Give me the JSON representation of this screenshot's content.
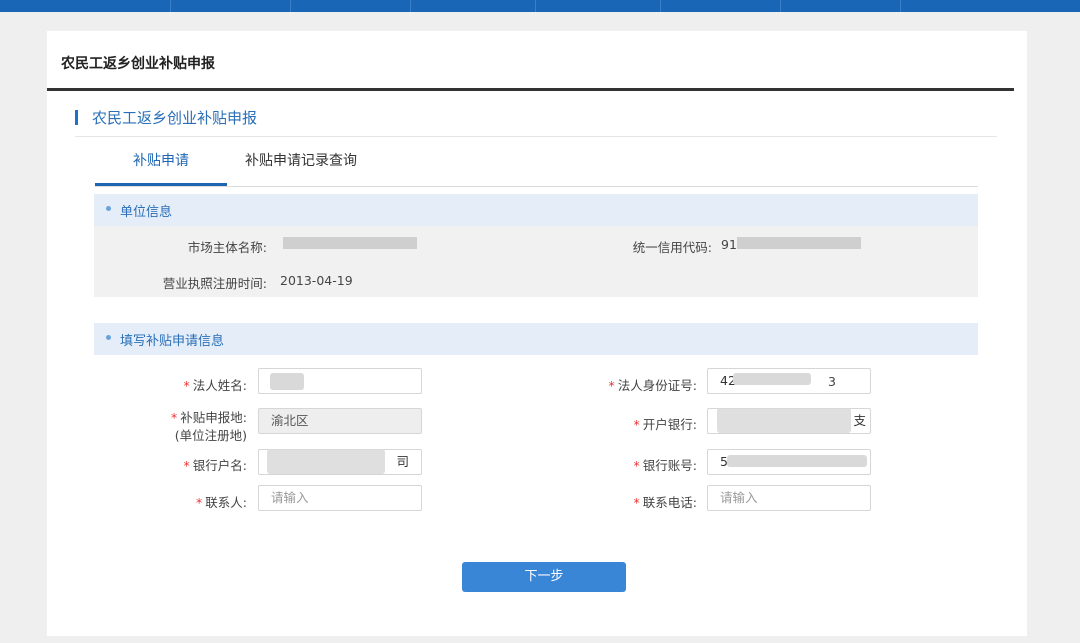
{
  "page_title": "农民工返乡创业补贴申报",
  "section_title": "农民工返乡创业补贴申报",
  "tabs": [
    {
      "label": "补贴申请",
      "active": true
    },
    {
      "label": "补贴申请记录查询",
      "active": false
    }
  ],
  "unit_info": {
    "heading": "单位信息",
    "market_name_label": "市场主体名称:",
    "market_name_value": "",
    "credit_code_label": "统一信用代码:",
    "credit_code_value": "91",
    "license_date_label": "营业执照注册时间:",
    "license_date_value": "2013-04-19"
  },
  "apply_info": {
    "heading": "填写补贴申请信息",
    "required_mark": "*",
    "legal_name": {
      "label": "法人姓名:",
      "value": ""
    },
    "legal_id": {
      "label": "法人身份证号:",
      "value": "42",
      "tail": "3"
    },
    "region": {
      "label": "补贴申报地:",
      "sublabel": "(单位注册地)",
      "value": "渝北区"
    },
    "bank": {
      "label": "开户银行:",
      "value": "支"
    },
    "account_name": {
      "label": "银行户名:",
      "value": "司"
    },
    "account_no": {
      "label": "银行账号:",
      "value": "5"
    },
    "contact": {
      "label": "联系人:",
      "placeholder": "请输入"
    },
    "phone": {
      "label": "联系电话:",
      "placeholder": "请输入"
    }
  },
  "next_button": "下一步",
  "colors": {
    "brand": "#1966b6",
    "button": "#3a86d6",
    "required": "#ee3333"
  }
}
